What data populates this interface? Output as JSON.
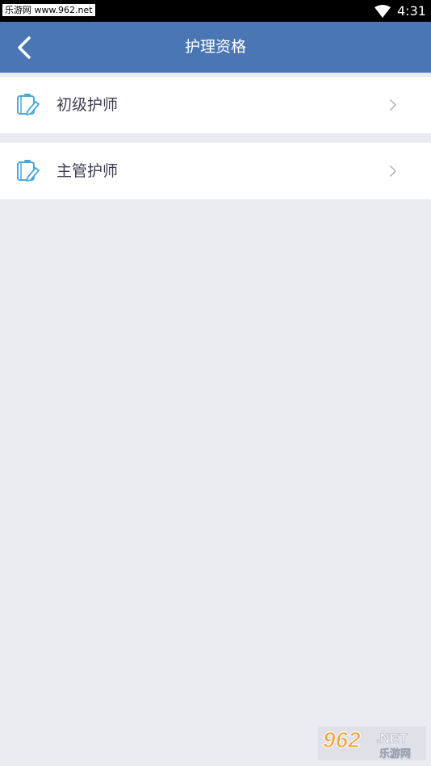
{
  "status_bar": {
    "watermark_text": "乐游网 www.962.net",
    "time": "4:31"
  },
  "app_bar": {
    "title": "护理资格"
  },
  "list": {
    "items": [
      {
        "label": "初级护师",
        "icon": "notebook-pencil-icon"
      },
      {
        "label": "主管护师",
        "icon": "notebook-pencil-icon"
      }
    ]
  },
  "watermark_logo": {
    "brand": "962",
    "suffix": ".NET",
    "tagline": "乐游网"
  },
  "colors": {
    "app_bar": "#4a76b4",
    "background": "#ebecf1",
    "item_icon": "#4aa8d8",
    "label": "#3e3e52"
  }
}
